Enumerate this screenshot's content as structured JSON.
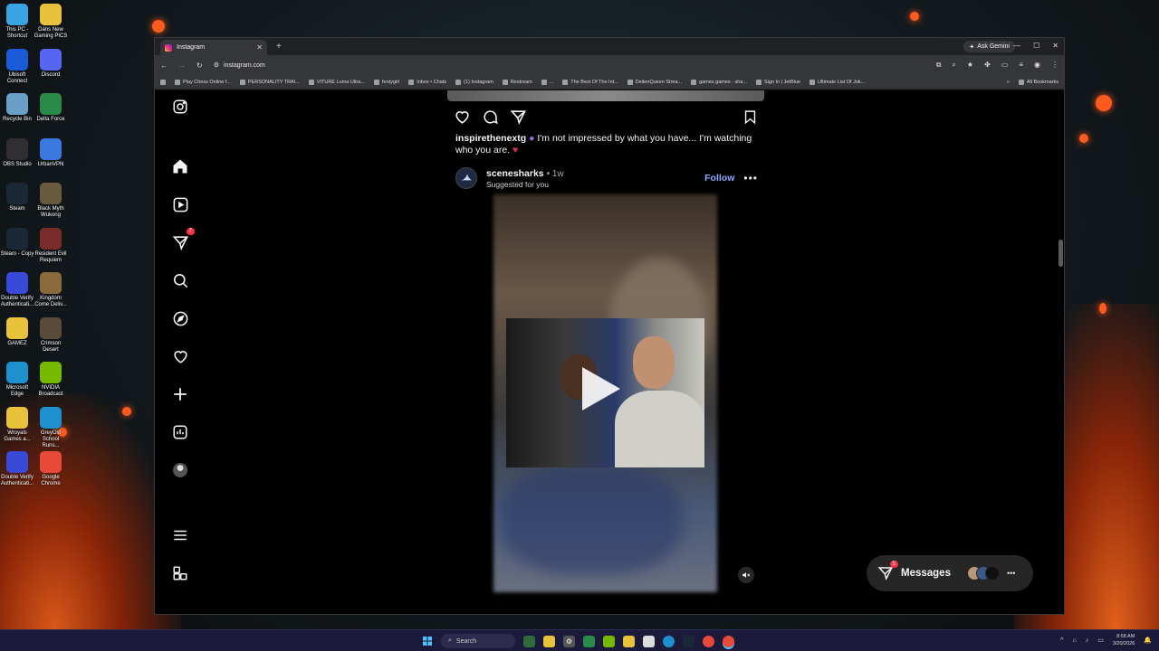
{
  "desktop": {
    "icons": [
      {
        "label": "This PC - Shortcut",
        "color": "#3aa3e3"
      },
      {
        "label": "Dans New Gaming PICS",
        "color": "#e8c23a"
      },
      {
        "label": "Ubisoft Connect",
        "color": "#1a5cd8"
      },
      {
        "label": "Discord",
        "color": "#5865f2"
      },
      {
        "label": "Recycle Bin",
        "color": "#6aa0c8"
      },
      {
        "label": "Delta Force",
        "color": "#2a8a4a"
      },
      {
        "label": "OBS Studio",
        "color": "#302e31"
      },
      {
        "label": "UrbanVPN",
        "color": "#3a7ae0"
      },
      {
        "label": "Steam",
        "color": "#1b2838"
      },
      {
        "label": "Black Myth Wukong",
        "color": "#6a5a40"
      },
      {
        "label": "Steam - Copy",
        "color": "#1b2838"
      },
      {
        "label": "Resident Evil Requiem",
        "color": "#7a2a2a"
      },
      {
        "label": "Double Verify Authenticati...",
        "color": "#3a4ad8"
      },
      {
        "label": "Kingdom Come Deliv...",
        "color": "#8a6a3a"
      },
      {
        "label": "GAMEZ",
        "color": "#e8c23a"
      },
      {
        "label": "Crimson Desert",
        "color": "#5a4a3a"
      },
      {
        "label": "Microsoft Edge",
        "color": "#1e90d0"
      },
      {
        "label": "NVIDIA Broadcast",
        "color": "#76b900"
      },
      {
        "label": "Wroyals Games a...",
        "color": "#e8c23a"
      },
      {
        "label": "GreyOld School Runs...",
        "color": "#1e90d0"
      },
      {
        "label": "Double Verify Authenticati...",
        "color": "#3a4ad8"
      },
      {
        "label": "Google Chrome",
        "color": "#e84a3a"
      }
    ]
  },
  "browser": {
    "tab_title": "Instagram",
    "new_tab": "+",
    "ask_gemini": "Ask Gemini",
    "url": "instagram.com",
    "bookmarks": [
      "Play Chess Online f...",
      "PERSONALITY TRAI...",
      "VITURE Luma Ultra...",
      "fentygirl",
      "Inbox • Chats",
      "(1) Instagram",
      "Restream",
      "...",
      "The Best Of The Int...",
      "DeilenQueen Strea...",
      "games games - sha...",
      "Sign In | JetBlue",
      "Ultimate List Of Jok..."
    ],
    "bookmarks_overflow": "»",
    "all_bookmarks": "All Bookmarks"
  },
  "instagram": {
    "nav_badge": "7",
    "previous_post": {
      "caption_user": "inspirethenextg",
      "caption_text": "I'm not impressed by what you have... I'm watching who you are."
    },
    "post": {
      "username": "scenesharks",
      "time": "1w",
      "suggested": "Suggested for you",
      "follow": "Follow"
    },
    "messages": {
      "label": "Messages",
      "badge": "5"
    }
  },
  "taskbar": {
    "search": "Search",
    "time": "8:58 AM",
    "date": "3/20/2026"
  }
}
